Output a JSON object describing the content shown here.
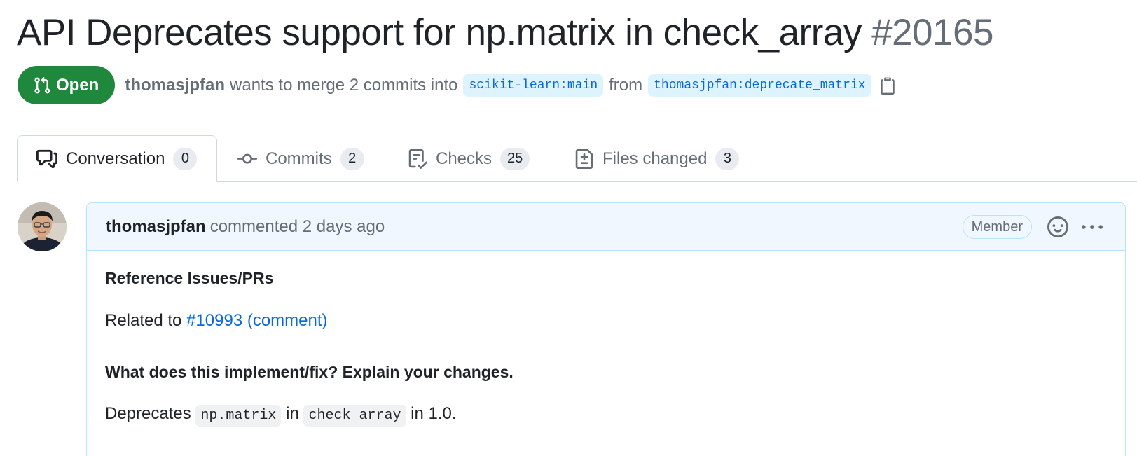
{
  "pr": {
    "title": "API Deprecates support for np.matrix in check_array",
    "number": "#20165",
    "state": "Open",
    "author": "thomasjpfan",
    "merge_text": "wants to merge 2 commits into",
    "base_branch": "scikit-learn:main",
    "from_text": "from",
    "head_branch": "thomasjpfan:deprecate_matrix"
  },
  "tabs": [
    {
      "label": "Conversation",
      "count": "0",
      "icon": "comment-discussion-icon"
    },
    {
      "label": "Commits",
      "count": "2",
      "icon": "git-commit-icon"
    },
    {
      "label": "Checks",
      "count": "25",
      "icon": "checklist-icon"
    },
    {
      "label": "Files changed",
      "count": "3",
      "icon": "file-diff-icon"
    }
  ],
  "comment": {
    "author": "thomasjpfan",
    "action": "commented 2 days ago",
    "badge": "Member",
    "body": {
      "heading1": "Reference Issues/PRs",
      "related_prefix": "Related to",
      "related_link": "#10993 (comment)",
      "heading2": "What does this implement/fix? Explain your changes.",
      "dep_prefix": "Deprecates",
      "code1": "np.matrix",
      "dep_mid": "in",
      "code2": "check_array",
      "dep_suffix": "in 1.0."
    }
  },
  "colors": {
    "open_green": "#1f883d",
    "link_blue": "#0969da",
    "branch_bg": "#ddf4ff",
    "comment_header_bg": "#f0f7ff"
  }
}
